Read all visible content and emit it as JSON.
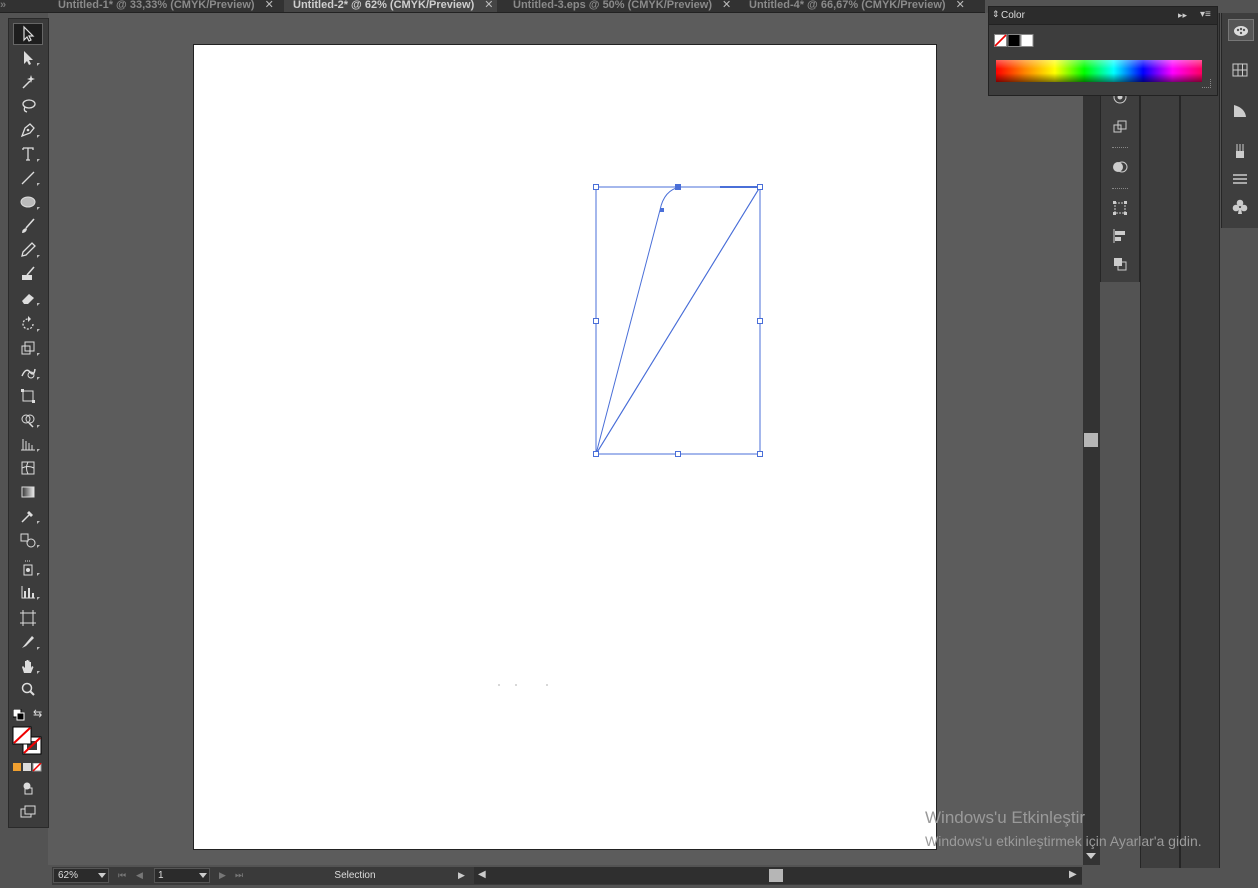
{
  "tabs": [
    {
      "label": "Untitled-1* @ 33,33% (CMYK/Preview)",
      "active": false
    },
    {
      "label": "Untitled-2* @ 62% (CMYK/Preview)",
      "active": true
    },
    {
      "label": "Untitled-3.eps @ 50% (CMYK/Preview)",
      "active": false
    },
    {
      "label": "Untitled-4* @ 66,67% (CMYK/Preview)",
      "active": false
    }
  ],
  "color_panel": {
    "title": "Color"
  },
  "status": {
    "zoom": "62%",
    "page": "1",
    "tool_name": "Selection"
  },
  "watermark": {
    "line1": "Windows'u Etkinleştir",
    "line2": "Windows'u etkinleştirmek için Ayarlar'a gidin."
  },
  "tools": [
    "selection-tool-icon",
    "direct-selection-tool-icon",
    "magic-wand-tool-icon",
    "lasso-tool-icon",
    "pen-tool-icon",
    "type-tool-icon",
    "line-segment-tool-icon",
    "ellipse-tool-icon",
    "paintbrush-tool-icon",
    "pencil-tool-icon",
    "blob-brush-tool-icon",
    "eraser-tool-icon",
    "rotate-tool-icon",
    "scale-tool-icon",
    "warp-tool-icon",
    "free-transform-tool-icon",
    "shape-builder-tool-icon",
    "perspective-grid-tool-icon",
    "mesh-tool-icon",
    "gradient-tool-icon",
    "eyedropper-tool-icon",
    "blend-tool-icon",
    "symbol-sprayer-tool-icon",
    "column-graph-tool-icon",
    "artboard-tool-icon",
    "slice-tool-icon",
    "hand-tool-icon",
    "zoom-tool-icon"
  ]
}
